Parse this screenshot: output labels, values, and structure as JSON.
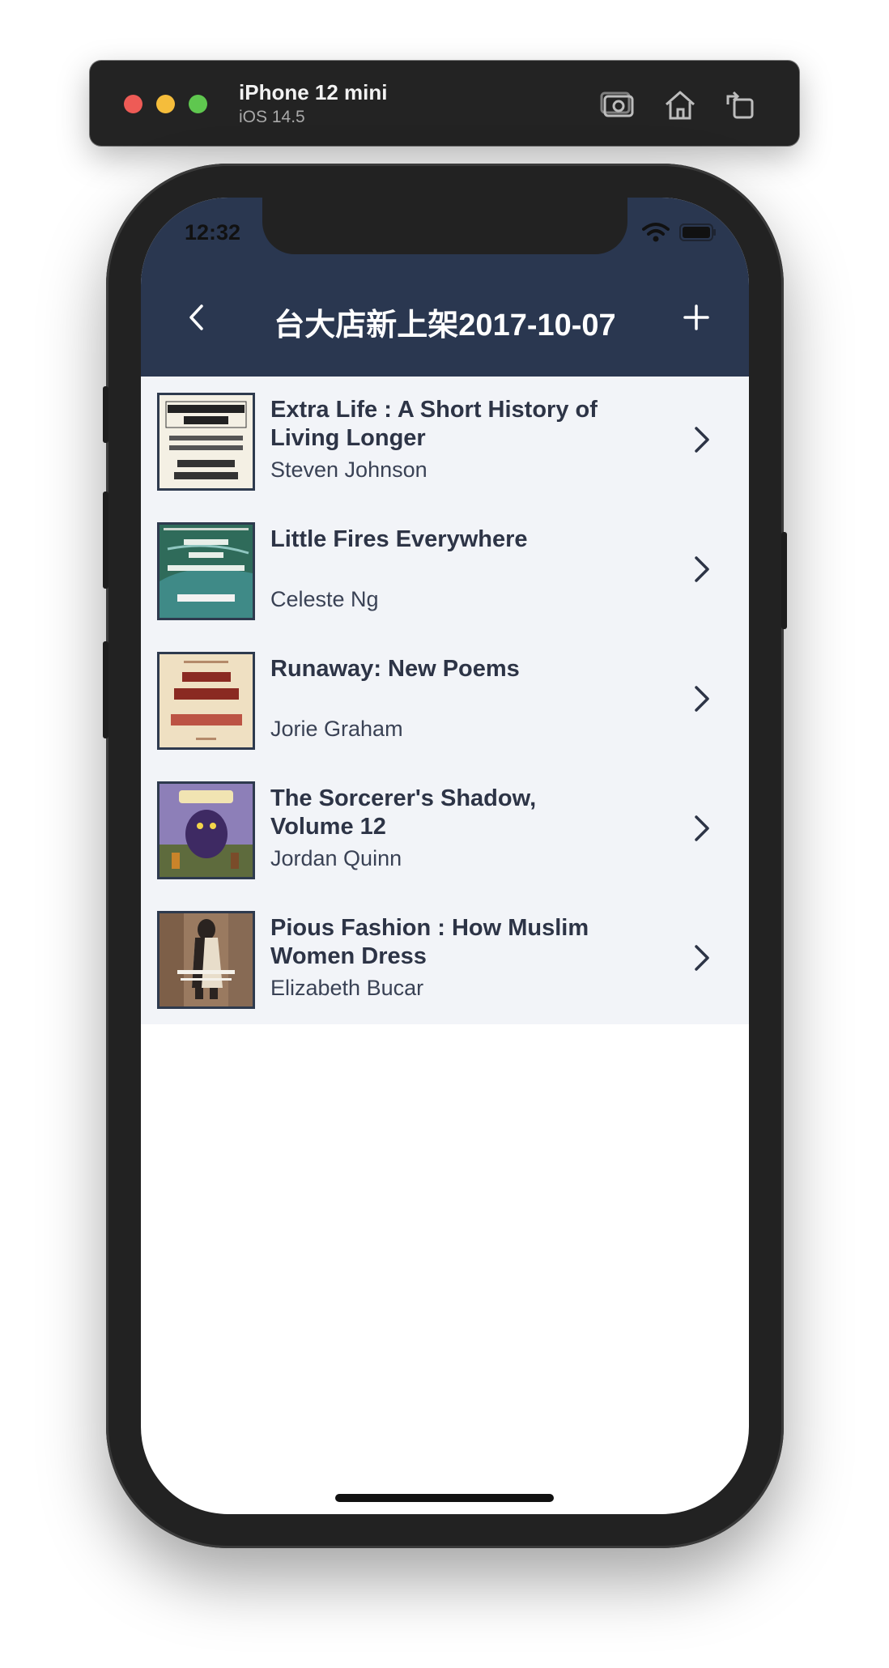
{
  "simulator": {
    "device_name": "iPhone 12 mini",
    "os_version": "iOS 14.5",
    "buttons": [
      "screenshot-icon",
      "home-icon",
      "rotate-icon"
    ]
  },
  "status_bar": {
    "time": "12:32"
  },
  "nav": {
    "title": "台大店新上架2017-10-07",
    "back_icon": "chevron-left-icon",
    "add_icon": "plus-icon"
  },
  "books": [
    {
      "title": "Extra Life : A Short History of Living Longer",
      "author": "Steven Johnson"
    },
    {
      "title": "Little Fires Everywhere",
      "author": "Celeste Ng"
    },
    {
      "title": "Runaway: New Poems",
      "author": "Jorie Graham"
    },
    {
      "title": "The Sorcerer's Shadow, Volume 12",
      "author": "Jordan Quinn"
    },
    {
      "title": "Pious Fashion : How Muslim Women Dress",
      "author": "Elizabeth Bucar"
    }
  ],
  "colors": {
    "nav_background": "#2a3750",
    "list_background": "#f2f4f8",
    "text_primary": "#2d3446"
  }
}
